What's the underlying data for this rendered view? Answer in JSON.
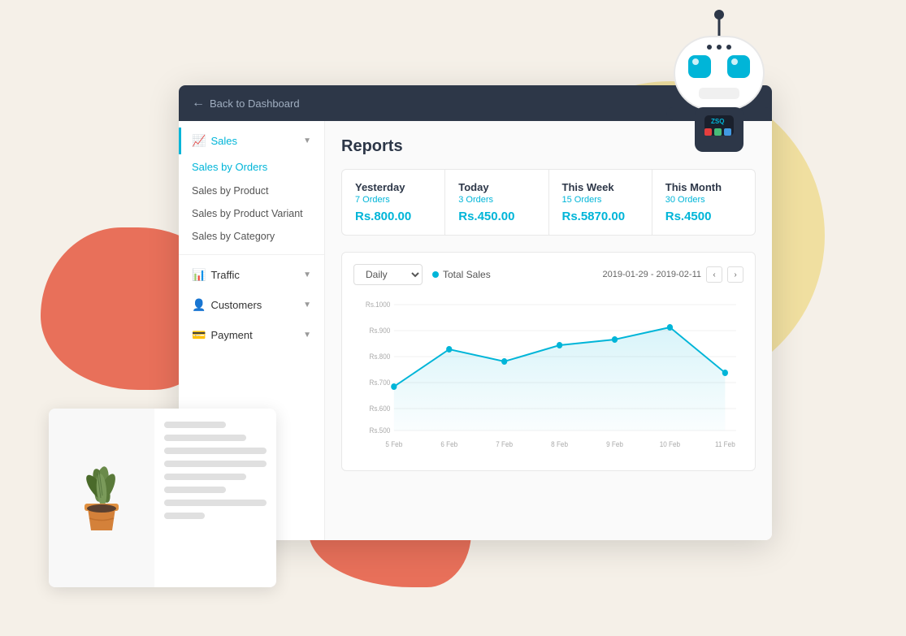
{
  "background": {
    "coral_left": true,
    "yellow_circle": true,
    "coral_bottom": true
  },
  "nav": {
    "back_label": "Back to Dashboard"
  },
  "sidebar": {
    "sales_label": "Sales",
    "items": [
      {
        "id": "sales-by-orders",
        "label": "Sales by Orders",
        "active": true
      },
      {
        "id": "sales-by-product",
        "label": "Sales by Product",
        "active": false
      },
      {
        "id": "sales-by-product-variant",
        "label": "Sales by Product Variant",
        "active": false
      },
      {
        "id": "sales-by-category",
        "label": "Sales by Category",
        "active": false
      }
    ],
    "other_sections": [
      {
        "id": "traffic",
        "label": "Traffic",
        "has_arrow": true
      },
      {
        "id": "customers",
        "label": "Customers",
        "has_arrow": true
      },
      {
        "id": "payment",
        "label": "Payment",
        "has_arrow": true
      }
    ]
  },
  "main": {
    "title": "Reports",
    "stats": [
      {
        "period": "Yesterday",
        "orders": "7 Orders",
        "value": "Rs.800.00"
      },
      {
        "period": "Today",
        "orders": "3 Orders",
        "value": "Rs.450.00"
      },
      {
        "period": "This Week",
        "orders": "15 Orders",
        "value": "Rs.5870.00"
      },
      {
        "period": "This Month",
        "orders": "30 Orders",
        "value": "Rs.4500"
      }
    ],
    "chart": {
      "filter": "Daily",
      "legend": "Total Sales",
      "date_range": "2019-01-29 - 2019-02-11",
      "y_labels": [
        "Rs.1000",
        "Rs.900",
        "Rs.800",
        "Rs.700",
        "Rs.600",
        "Rs.500"
      ],
      "x_labels": [
        "5 Feb",
        "6 Feb",
        "7 Feb",
        "8 Feb",
        "9 Feb",
        "10 Feb",
        "11 Feb"
      ],
      "data_points": [
        {
          "x": 0,
          "y": 0.35
        },
        {
          "x": 1,
          "y": 0.65
        },
        {
          "x": 2,
          "y": 0.55
        },
        {
          "x": 3,
          "y": 0.68
        },
        {
          "x": 4,
          "y": 0.72
        },
        {
          "x": 5,
          "y": 0.82
        },
        {
          "x": 6,
          "y": 0.46
        }
      ]
    }
  },
  "robot": {
    "label_text": "ZSQ"
  }
}
